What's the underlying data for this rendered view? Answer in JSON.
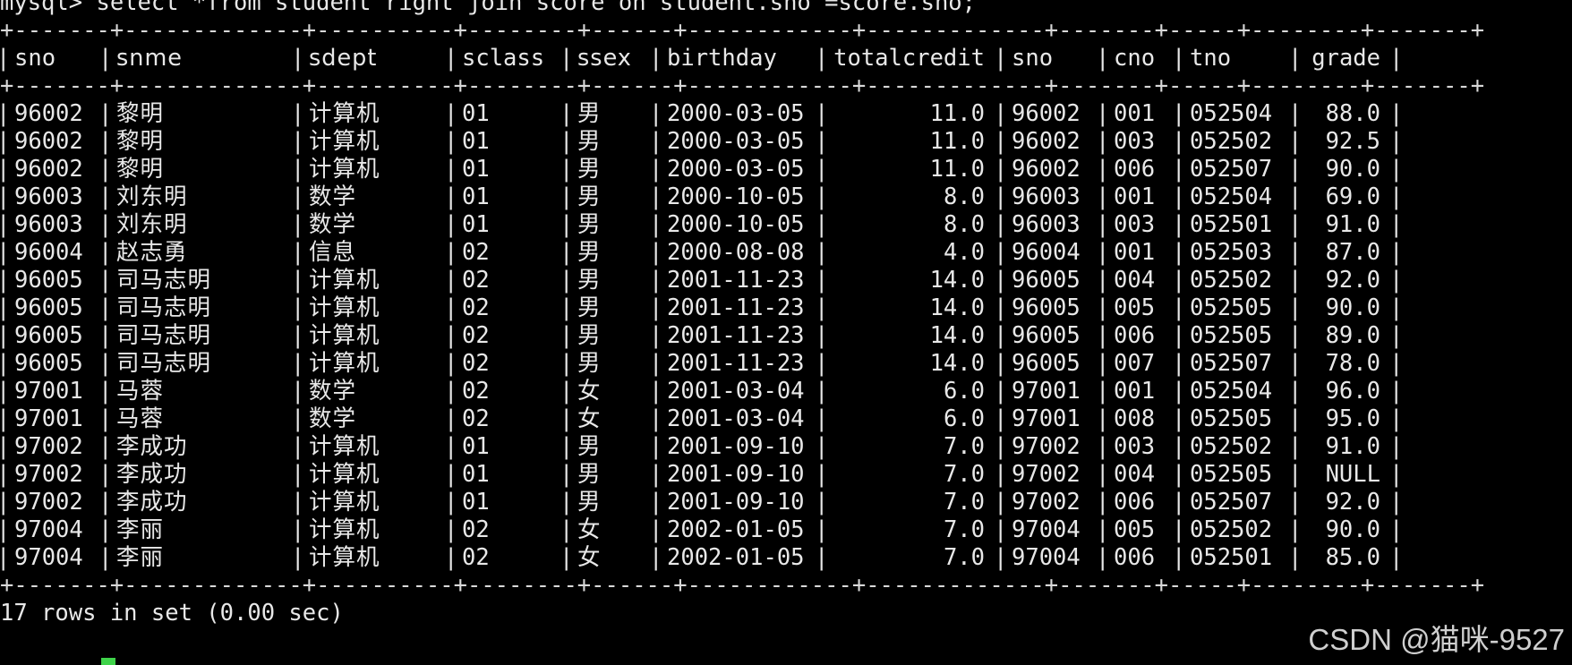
{
  "terminal": {
    "command_line": "mysql> select *from student right join score on student.sno =score.sno;",
    "separator": "+-------+-------------+----------+--------+------+------------+-------------+-------+-----+--------+-------+",
    "status_line": "17 rows in set (0.00 sec)"
  },
  "table": {
    "columns": [
      "sno",
      "snme",
      "sdept",
      "sclass",
      "ssex",
      "birthday",
      "totalcredit",
      "sno",
      "cno",
      "tno",
      "grade"
    ],
    "rows": [
      [
        "96002",
        "黎明",
        "计算机",
        "01",
        "男",
        "2000-03-05",
        "11.0",
        "96002",
        "001",
        "052504",
        "88.0"
      ],
      [
        "96002",
        "黎明",
        "计算机",
        "01",
        "男",
        "2000-03-05",
        "11.0",
        "96002",
        "003",
        "052502",
        "92.5"
      ],
      [
        "96002",
        "黎明",
        "计算机",
        "01",
        "男",
        "2000-03-05",
        "11.0",
        "96002",
        "006",
        "052507",
        "90.0"
      ],
      [
        "96003",
        "刘东明",
        "数学",
        "01",
        "男",
        "2000-10-05",
        "8.0",
        "96003",
        "001",
        "052504",
        "69.0"
      ],
      [
        "96003",
        "刘东明",
        "数学",
        "01",
        "男",
        "2000-10-05",
        "8.0",
        "96003",
        "003",
        "052501",
        "91.0"
      ],
      [
        "96004",
        "赵志勇",
        "信息",
        "02",
        "男",
        "2000-08-08",
        "4.0",
        "96004",
        "001",
        "052503",
        "87.0"
      ],
      [
        "96005",
        "司马志明",
        "计算机",
        "02",
        "男",
        "2001-11-23",
        "14.0",
        "96005",
        "004",
        "052502",
        "92.0"
      ],
      [
        "96005",
        "司马志明",
        "计算机",
        "02",
        "男",
        "2001-11-23",
        "14.0",
        "96005",
        "005",
        "052505",
        "90.0"
      ],
      [
        "96005",
        "司马志明",
        "计算机",
        "02",
        "男",
        "2001-11-23",
        "14.0",
        "96005",
        "006",
        "052505",
        "89.0"
      ],
      [
        "96005",
        "司马志明",
        "计算机",
        "02",
        "男",
        "2001-11-23",
        "14.0",
        "96005",
        "007",
        "052507",
        "78.0"
      ],
      [
        "97001",
        "马蓉",
        "数学",
        "02",
        "女",
        "2001-03-04",
        "6.0",
        "97001",
        "001",
        "052504",
        "96.0"
      ],
      [
        "97001",
        "马蓉",
        "数学",
        "02",
        "女",
        "2001-03-04",
        "6.0",
        "97001",
        "008",
        "052505",
        "95.0"
      ],
      [
        "97002",
        "李成功",
        "计算机",
        "01",
        "男",
        "2001-09-10",
        "7.0",
        "97002",
        "003",
        "052502",
        "91.0"
      ],
      [
        "97002",
        "李成功",
        "计算机",
        "01",
        "男",
        "2001-09-10",
        "7.0",
        "97002",
        "004",
        "052505",
        "NULL"
      ],
      [
        "97002",
        "李成功",
        "计算机",
        "01",
        "男",
        "2001-09-10",
        "7.0",
        "97002",
        "006",
        "052507",
        "92.0"
      ],
      [
        "97004",
        "李丽",
        "计算机",
        "02",
        "女",
        "2002-01-05",
        "7.0",
        "97004",
        "005",
        "052502",
        "90.0"
      ],
      [
        "97004",
        "李丽",
        "计算机",
        "02",
        "女",
        "2002-01-05",
        "7.0",
        "97004",
        "006",
        "052501",
        "85.0"
      ]
    ]
  },
  "watermark": "CSDN @猫咪-9527",
  "colors": {
    "background": "#000000",
    "text": "#e8e8e8",
    "cursor": "#3fd34a"
  }
}
